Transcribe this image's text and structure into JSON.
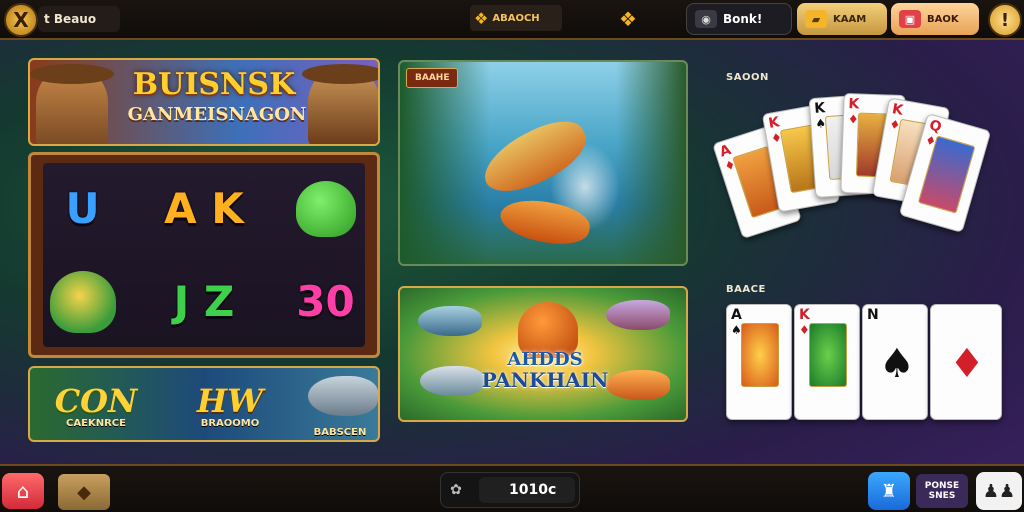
{
  "topbar": {
    "logo_glyph": "X",
    "brand": "t Beauo",
    "center_title": "ABAOCH",
    "balance_label": "Bonk!",
    "pill_gold_label": "KAAM",
    "pill_orange_label": "BAOK",
    "help_glyph": "!"
  },
  "left": {
    "banner_top": {
      "title": "BUISNSK",
      "subtitle": "GANMEISNAGON"
    },
    "slot_symbols": [
      "",
      "A K",
      "",
      "",
      "",
      "J Z",
      "30"
    ],
    "slot_row1": [
      "U",
      "A K",
      ""
    ],
    "slot_row2": [
      "",
      "J Z",
      "30"
    ],
    "banner_bottom": {
      "item1_big": "CON",
      "item1_small": "CAEKNRCE",
      "item2_big": "HW",
      "item2_small": "BRAOOMO",
      "item3_small": "BABSCEN"
    }
  },
  "middle": {
    "river_tag": "BAAHE",
    "fish_game_title_1": "AHDDS",
    "fish_game_title_2": "PANKHAIN"
  },
  "right": {
    "hand1_label": "SAOON",
    "hand2_label": "BAACE",
    "hand1_cards": [
      {
        "rank": "A",
        "suit": "♦",
        "color": "red"
      },
      {
        "rank": "K",
        "suit": "♦",
        "color": "red"
      },
      {
        "rank": "K",
        "suit": "♠",
        "color": "black"
      },
      {
        "rank": "K",
        "suit": "♦",
        "color": "red"
      },
      {
        "rank": "K",
        "suit": "♦",
        "color": "red"
      },
      {
        "rank": "Q",
        "suit": "♦",
        "color": "red"
      }
    ],
    "hand2_cards": [
      {
        "rank": "A",
        "suit": "♠",
        "color": "black"
      },
      {
        "rank": "K",
        "suit": "♦",
        "color": "red"
      },
      {
        "rank": "N",
        "suit": "♠",
        "color": "black"
      },
      {
        "rank": "",
        "suit": "♦",
        "color": "red"
      }
    ]
  },
  "bottombar": {
    "home_icon": "home-icon",
    "coin_value": "1010c",
    "promo_label": "PONSE SNES"
  },
  "colors": {
    "accent_gold": "#d9a847",
    "topbar_bg": "#0f0c0a",
    "home_red": "#d22a3a",
    "castle_blue": "#1a6ad8"
  }
}
